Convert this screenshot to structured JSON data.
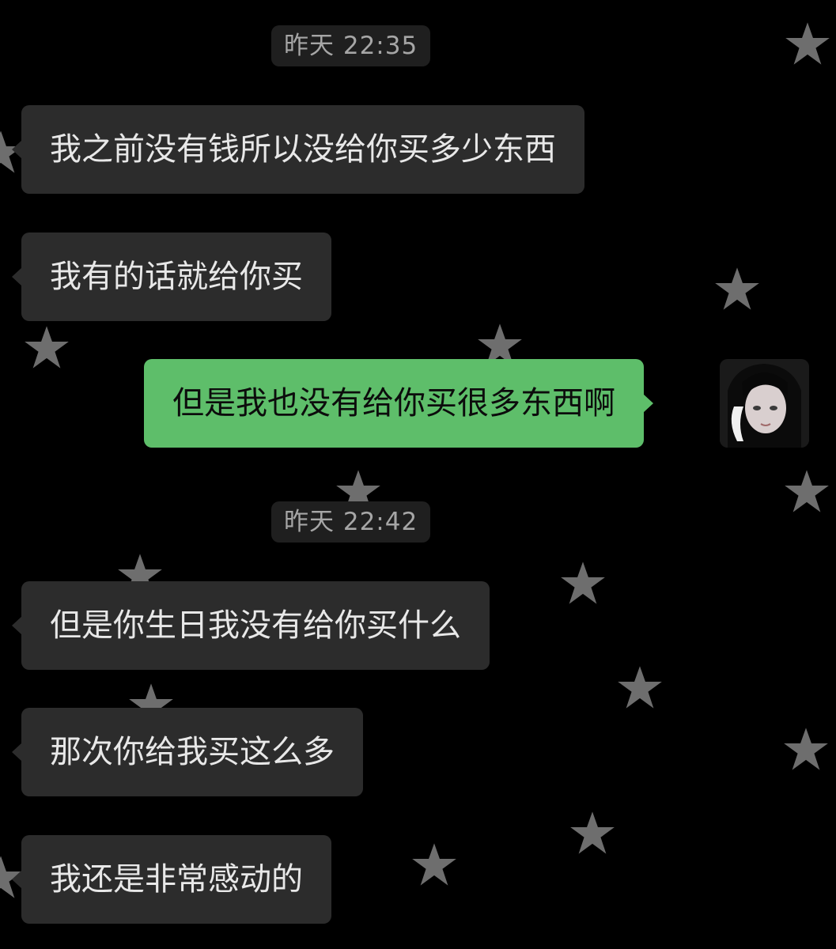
{
  "chat": {
    "timestamps": [
      "昨天 22:35",
      "昨天 22:42"
    ],
    "messages": [
      {
        "side": "incoming",
        "text": "我之前没有钱所以没给你买多少东西"
      },
      {
        "side": "incoming",
        "text": "我有的话就给你买"
      },
      {
        "side": "outgoing",
        "text": "但是我也没有给你买很多东西啊"
      },
      {
        "side": "incoming",
        "text": "但是你生日我没有给你买什么"
      },
      {
        "side": "incoming",
        "text": "那次你给我买这么多"
      },
      {
        "side": "incoming",
        "text": "我还是非常感动的"
      }
    ]
  },
  "background": {
    "color": "#000000",
    "pattern_icon": "star-icon",
    "star_color": "#6e6e6e"
  },
  "colors": {
    "incoming_bubble": "#2c2c2c",
    "outgoing_bubble": "#5ebe6a",
    "timestamp_bg": "#1f1f1f"
  },
  "avatar": {
    "icon": "user-avatar-photo"
  }
}
